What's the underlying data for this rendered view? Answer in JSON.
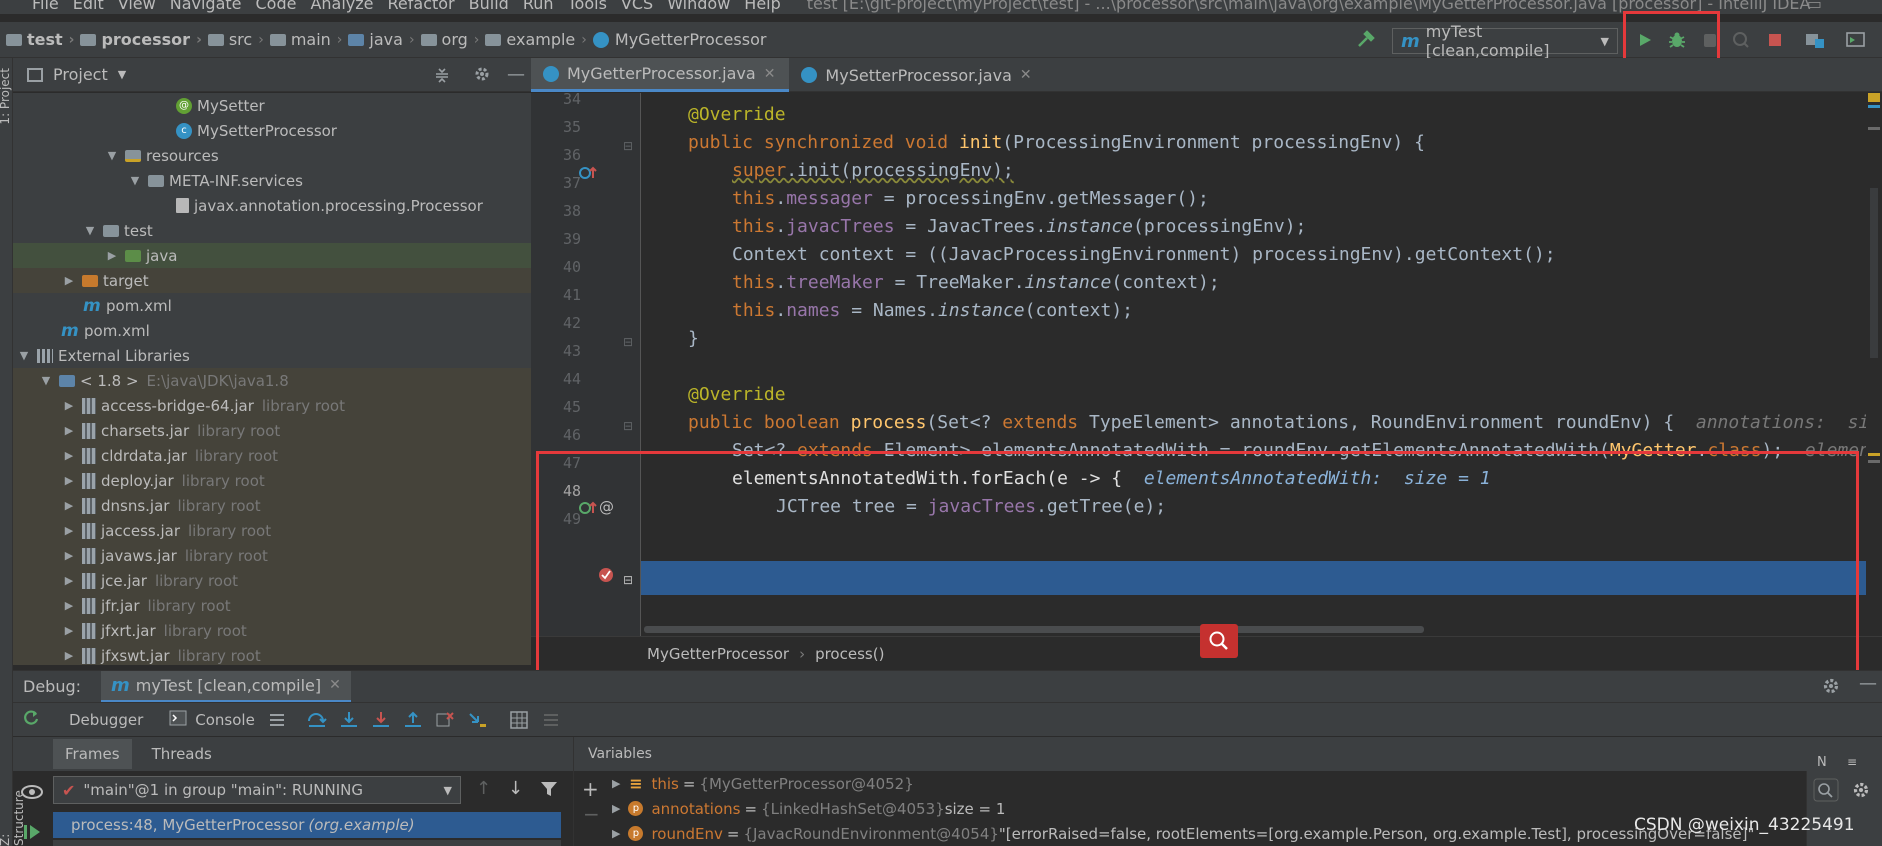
{
  "menu": {
    "items": [
      "File",
      "Edit",
      "View",
      "Navigate",
      "Code",
      "Analyze",
      "Refactor",
      "Build",
      "Run",
      "Tools",
      "VCS",
      "Window",
      "Help"
    ],
    "window_title": "test [E:\\git-project\\myProject\\test] - ...\\processor\\src\\main\\java\\org\\example\\MyGetterProcessor.java [processor] - IntelliJ IDEA"
  },
  "breadcrumbs": [
    "test",
    "processor",
    "src",
    "main",
    "java",
    "org",
    "example",
    "MyGetterProcessor"
  ],
  "run_config": {
    "label": "myTest [clean,compile]"
  },
  "project_panel": {
    "title": "Project",
    "tree": [
      {
        "label": "MySetter",
        "icon": "annotation-icon",
        "extra": ""
      },
      {
        "label": "MySetterProcessor",
        "icon": "class-icon",
        "extra": ""
      },
      {
        "label": "resources",
        "icon": "resources-folder-icon",
        "extra": ""
      },
      {
        "label": "META-INF.services",
        "icon": "folder-icon",
        "extra": ""
      },
      {
        "label": "javax.annotation.processing.Processor",
        "icon": "file-icon",
        "extra": ""
      },
      {
        "label": "test",
        "icon": "folder-icon",
        "extra": ""
      },
      {
        "label": "java",
        "icon": "test-source-folder-icon",
        "extra": ""
      },
      {
        "label": "target",
        "icon": "excluded-folder-icon",
        "extra": ""
      },
      {
        "label": "pom.xml",
        "icon": "maven-icon",
        "extra": ""
      },
      {
        "label": "pom.xml",
        "icon": "maven-icon",
        "extra": ""
      },
      {
        "label": "External Libraries",
        "icon": "library-icon",
        "extra": ""
      },
      {
        "label": "< 1.8 >",
        "icon": "jdk-icon",
        "extra": "E:\\java\\JDK\\java1.8"
      },
      {
        "label": "access-bridge-64.jar",
        "icon": "jar-icon",
        "extra": "library root"
      },
      {
        "label": "charsets.jar",
        "icon": "jar-icon",
        "extra": "library root"
      },
      {
        "label": "cldrdata.jar",
        "icon": "jar-icon",
        "extra": "library root"
      },
      {
        "label": "deploy.jar",
        "icon": "jar-icon",
        "extra": "library root"
      },
      {
        "label": "dnsns.jar",
        "icon": "jar-icon",
        "extra": "library root"
      },
      {
        "label": "jaccess.jar",
        "icon": "jar-icon",
        "extra": "library root"
      },
      {
        "label": "javaws.jar",
        "icon": "jar-icon",
        "extra": "library root"
      },
      {
        "label": "jce.jar",
        "icon": "jar-icon",
        "extra": "library root"
      },
      {
        "label": "jfr.jar",
        "icon": "jar-icon",
        "extra": "library root"
      },
      {
        "label": "jfxrt.jar",
        "icon": "jar-icon",
        "extra": "library root"
      },
      {
        "label": "jfxswt.jar",
        "icon": "jar-icon",
        "extra": "library root"
      }
    ]
  },
  "editor": {
    "tabs": [
      {
        "label": "MyGetterProcessor.java",
        "active": true
      },
      {
        "label": "MySetterProcessor.java",
        "active": false
      }
    ],
    "lines": {
      "l34": "34",
      "l35": "35",
      "l36": "36",
      "l37": "37",
      "l38": "38",
      "l39": "39",
      "l40": "40",
      "l41": "41",
      "l42": "42",
      "l43": "43",
      "l44": "44",
      "l45": "45",
      "l46": "46",
      "l47": "47",
      "l48": "48",
      "l49": "49"
    },
    "code": {
      "override": "@Override",
      "c36a": "public synchronized void ",
      "c36b": "init",
      "c36c": "(ProcessingEnvironment processingEnv) {",
      "c37a": "super",
      "c37b": ".init(processingEnv);",
      "c38a": "this",
      "c38b": ".",
      "c38c": "messager",
      "c38d": " = processingEnv.getMessager();",
      "c39c": "javacTrees",
      "c39d": " = JavacTrees.",
      "c39e": "instance",
      "c39f": "(processingEnv);",
      "c40": "Context context = ((JavacProcessingEnvironment) processingEnv).getContext();",
      "c41c": "treeMaker",
      "c41d": " = TreeMaker.",
      "c41f": "(context);",
      "c42c": "names",
      "c42d": " = Names.",
      "c43": "}",
      "c46a": "public boolean ",
      "c46b": "process",
      "c46c": "(Set<? ",
      "c46d": "extends",
      "c46e": " TypeElement> annotations, RoundEnvironment roundEnv) {  ",
      "c46hint": "annotations:  si",
      "c47a": "Set<? ",
      "c47b": "extends",
      "c47c": " Element> elementsAnnotatedWith = roundEnv.getElementsAnnotatedWith(",
      "c47d": "MyGetter",
      "c47e": ".",
      "c47f": "class",
      "c47g": ");  ",
      "c47hint": "elemen",
      "c48a": "elementsAnnotatedWith.forEach(e -> {  ",
      "c48hint": "elementsAnnotatedWith:  size = 1",
      "c49a": "JCTree tree = ",
      "c49b": "javacTrees",
      "c49c": ".getTree(e);"
    },
    "breadcrumb": {
      "class": "MyGetterProcessor",
      "method": "process()"
    }
  },
  "debug": {
    "label": "Debug:",
    "session": "myTest [clean,compile]",
    "tabs": {
      "debugger": "Debugger",
      "console": "Console"
    },
    "frames_tabs": {
      "frames": "Frames",
      "threads": "Threads"
    },
    "thread": "\"main\"@1 in group \"main\": RUNNING",
    "frame": {
      "name": "process:48, MyGetterProcessor ",
      "pkg": "(org.example)"
    },
    "variables_title": "Variables",
    "variables": [
      {
        "name": "this",
        "value": "{MyGetterProcessor@4052}",
        "extra": ""
      },
      {
        "name": "annotations",
        "value": "{LinkedHashSet@4053}",
        "extra": " size = 1"
      },
      {
        "name": "roundEnv",
        "value": "{JavacRoundEnvironment@4054}",
        "extra": " \"[errorRaised=false, rootElements=[org.example.Person, org.example.Test], processingOver=false]\""
      }
    ]
  },
  "left_strip": {
    "project": "1: Project",
    "structure": "Z: Structure"
  },
  "watermark": "CSDN @weixin_43225491",
  "colors": {
    "highlight": "#e5393b",
    "selection": "#2d5b91",
    "keyword": "#cc7832",
    "field": "#9876aa",
    "method": "#ffc66d"
  }
}
